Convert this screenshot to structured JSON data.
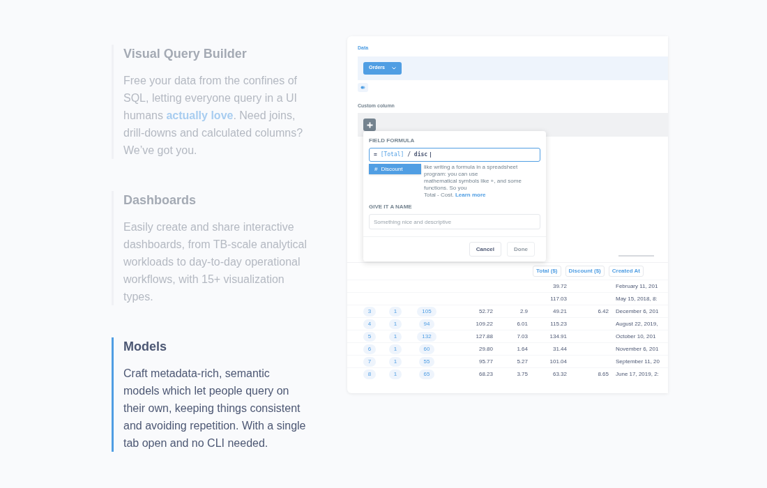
{
  "features": [
    {
      "title": "Visual Query Builder",
      "selected": false,
      "text_before": "Free your data from the confines of SQL, letting everyone query in a UI humans ",
      "link": "actually love",
      "text_after": ". Need joins, drill-downs and calculated columns? We’ve got you."
    },
    {
      "title": "Dashboards",
      "selected": false,
      "text_before": "Easily create and share interactive dashboards, from TB-scale analytical workloads to day-to-day operational workflows, with 15+ visualization types."
    },
    {
      "title": "Models",
      "selected": true,
      "text_before": "Craft metadata-rich, semantic models which let people query on their own, keeping things consistent and avoiding repetition. With a single tab open and no CLI needed."
    }
  ],
  "editor": {
    "data_label": "Data",
    "table_button": "Orders",
    "custom_column_label": "Custom column",
    "modal": {
      "formula_label": "FIELD FORMULA",
      "formula_prefix": "=",
      "formula_token": "[Total]",
      "formula_rest": "/ disc",
      "suggestion_icon": "#",
      "suggestion": "Discount",
      "help_lines": [
        "like writing a formula in a spreadsheet program: you can use",
        "mathematical symbols like +, and some functions. So you",
        "Total - Cost."
      ],
      "help_link": "Learn more",
      "name_label": "GIVE IT A NAME",
      "name_placeholder": "Something nice and descriptive",
      "cancel": "Cancel",
      "done": "Done",
      "done_disabled": true
    },
    "table": {
      "headers": [
        "Total ($)",
        "Discount ($)",
        "Created At"
      ],
      "rows": [
        {
          "cells": [
            null,
            null,
            null,
            null,
            null,
            "39.72",
            null,
            "February 11, 201"
          ]
        },
        {
          "cells": [
            null,
            null,
            null,
            null,
            null,
            "117.03",
            null,
            "May 15, 2018, 8:"
          ]
        },
        {
          "cells": [
            "3",
            "1",
            "105",
            "52.72",
            "2.9",
            "49.21",
            "6.42",
            "December 6, 201"
          ]
        },
        {
          "cells": [
            "4",
            "1",
            "94",
            "109.22",
            "6.01",
            "115.23",
            null,
            "August 22, 2019,"
          ]
        },
        {
          "cells": [
            "5",
            "1",
            "132",
            "127.88",
            "7.03",
            "134.91",
            null,
            "October 10, 201"
          ]
        },
        {
          "cells": [
            "6",
            "1",
            "60",
            "29.80",
            "1.64",
            "31.44",
            null,
            "November 6, 201"
          ]
        },
        {
          "cells": [
            "7",
            "1",
            "55",
            "95.77",
            "5.27",
            "101.04",
            null,
            "September 11, 20"
          ]
        },
        {
          "cells": [
            "8",
            "1",
            "65",
            "68.23",
            "3.75",
            "63.32",
            "8.65",
            "June 17, 2019, 2:"
          ]
        }
      ]
    }
  }
}
